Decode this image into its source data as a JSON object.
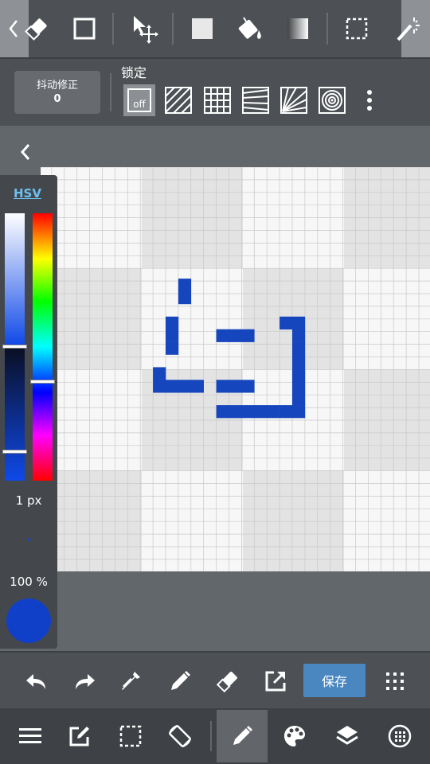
{
  "toolbar": {
    "tools": [
      "chevron-left",
      "eraser",
      "rectangle",
      "move",
      "fill-rect",
      "bucket-fill",
      "gradient",
      "marquee-select",
      "magic-wand"
    ]
  },
  "stabilizer": {
    "label": "抖动修正",
    "value": "0"
  },
  "lock": {
    "title": "锁定",
    "off_label": "off",
    "rulers": [
      "off",
      "parallel-lines",
      "grid",
      "perspective",
      "radial-lines",
      "concentric-circles"
    ]
  },
  "color_panel": {
    "mode_label": "HSV",
    "brush_size": "1 px",
    "opacity": "100 %",
    "current_color": "#1140c8",
    "hue_level": 0.69,
    "saturation_level": 0.1,
    "brightness_level": 0.2
  },
  "canvas": {
    "pixel_color": "#1646bd",
    "checker_light": "#f7f7f7",
    "checker_dark": "#e3e3e3"
  },
  "actions": {
    "save_label": "保存"
  },
  "bottom_nav": [
    "menu",
    "edit",
    "select",
    "rotate",
    "pen",
    "palette",
    "layers",
    "material"
  ]
}
